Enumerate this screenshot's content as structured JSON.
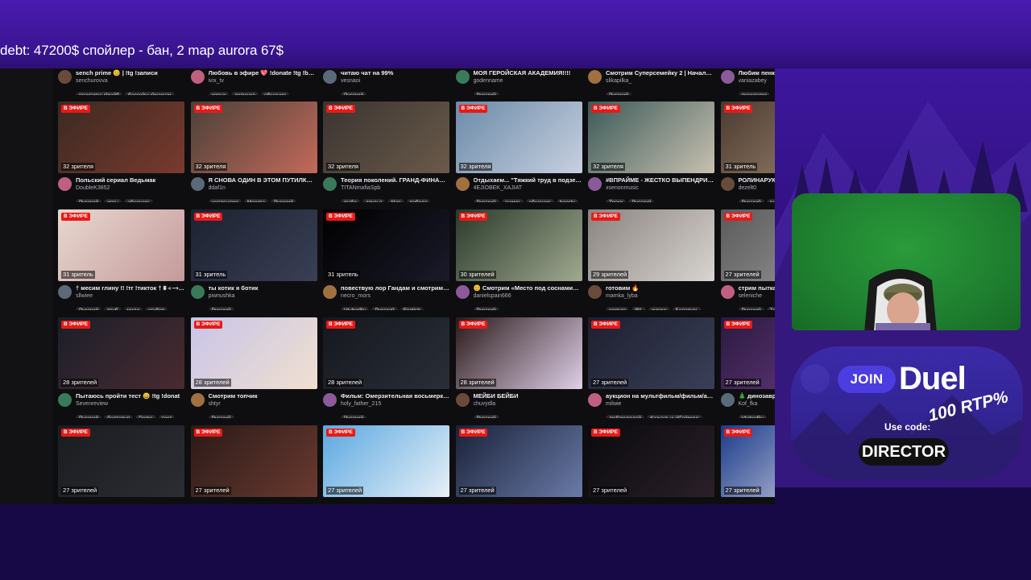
{
  "ticker": {
    "text": "debt: 47200$ спойлер - бан, 2 map aurora 67$"
  },
  "live_label": "В ЭФИРЕ",
  "colors": {
    "live_badge": "#e91916",
    "page_bg": "#0e0e10",
    "overlay_purple": "#3d179d",
    "greenscreen": "#1f8030"
  },
  "columns": [
    {
      "top": {
        "title": "sench prime 😊 | !tg !записи",
        "channel": "senchurovva",
        "tags": [
          "позитивныйвайб",
          "бассейныйжакузи"
        ]
      },
      "cards": [
        {
          "viewers": "32 зрителя",
          "title": "Польский сериал Ведьмак",
          "channel": "DoubleK3852",
          "tags": [
            "Русский",
            "игры",
            "общение"
          ],
          "thumb": [
            "#3a2a22",
            "#7a3a2e"
          ]
        },
        {
          "viewers": "31 зритель",
          "title": "† месим глину !! !тг !тикток † ⩩ ◃ ⟶ ⊀ ⟵",
          "channel": "sllwiee",
          "tags": [
            "Русский",
            "втуб",
            "мило",
            "ктубер"
          ],
          "thumb": [
            "#e8d8d0",
            "#c49a9a"
          ]
        },
        {
          "viewers": "28 зрителей",
          "title": "Пытаюсь пройти тест 😄 !tg !donat",
          "channel": "Sevenreview",
          "tags": [
            "Русский",
            "болтовня",
            "Demo",
            "тест"
          ],
          "thumb": [
            "#1a1f2a",
            "#4a2a30"
          ]
        },
        {
          "viewers": "27 зрителей",
          "title": "",
          "channel": "",
          "tags": [],
          "thumb": [
            "#1b1c20",
            "#2c2d33"
          ]
        }
      ]
    },
    {
      "top": {
        "title": "Любовь в эфире 💖 !donate !tg !boosty",
        "channel": "ivix_tv",
        "tags": [
          "хорни",
          "девушка",
          "общение"
        ]
      },
      "cards": [
        {
          "viewers": "32 зрителя",
          "title": "Я СНОВА ОДИН В ЭТОМ ПУТИЛКОВО ...",
          "channel": "ddaf1n",
          "tags": [
            "челленджи",
            "Москва",
            "Русский"
          ],
          "thumb": [
            "#4a4038",
            "#c26a5a"
          ]
        },
        {
          "viewers": "31 зритель",
          "title": "ты котик я ботик",
          "channel": "piwnushka",
          "tags": [
            "Русский"
          ],
          "thumb": [
            "#1c2230",
            "#3a3f55"
          ]
        },
        {
          "viewers": "28 зрителей",
          "title": "Смотрим топчик",
          "channel": "shtyr",
          "tags": [
            "Русский"
          ],
          "thumb": [
            "#c8c4e8",
            "#f0e0d0"
          ]
        },
        {
          "viewers": "27 зрителей",
          "title": "",
          "channel": "",
          "tags": [],
          "thumb": [
            "#2a1a18",
            "#6a3a30"
          ]
        }
      ]
    },
    {
      "top": {
        "title": "читаю чат на 99%",
        "channel": "vesnaoi",
        "tags": [
          "Русский"
        ]
      },
      "cards": [
        {
          "viewers": "32 зрителя",
          "title": "Теория поколений. ГРАНД-ФИНАЛ ко...",
          "channel": "TITANmafiaSpb",
          "tags": [
            "mafia",
            "друзья",
            "titan",
            "победа"
          ],
          "thumb": [
            "#3a3430",
            "#6a5a4a"
          ]
        },
        {
          "viewers": "31 зритель",
          "title": "повествую лор Гандам и смотрим Ган...",
          "channel": "necro_mors",
          "tags": [
            "VtuberRu",
            "Русский",
            "English"
          ],
          "thumb": [
            "#000000",
            "#1a1a2a"
          ]
        },
        {
          "viewers": "28 зрителей",
          "title": "Фильм: Омерзительная восьмерка. В...",
          "channel": "holy_father_215",
          "tags": [
            "Русский"
          ],
          "thumb": [
            "#15181e",
            "#2a2e38"
          ]
        },
        {
          "viewers": "27 зрителей",
          "title": "",
          "channel": "",
          "tags": [],
          "thumb": [
            "#5aa8e0",
            "#e8f0f8"
          ]
        }
      ]
    },
    {
      "top": {
        "title": "МОЯ ГЕРОЙСКАЯ АКАДЕМИЯ!!!!",
        "channel": "godenname",
        "tags": [
          "Русский"
        ]
      },
      "cards": [
        {
          "viewers": "32 зрителя",
          "title": "Отдыхаем... \"Тяжкий труд в подземе...",
          "channel": "4EJIOBEK_XAJIAT",
          "tags": [
            "Русский",
            "аниме",
            "общение",
            "boosty"
          ],
          "thumb": [
            "#6a8aa8",
            "#c8d0e0"
          ]
        },
        {
          "viewers": "30 зрителей",
          "title": "😊 Смотрим «Место под соснами» | !...",
          "channel": "danielspain666",
          "tags": [
            "Русский"
          ],
          "thumb": [
            "#2a3a2a",
            "#a0a890"
          ]
        },
        {
          "viewers": "28 зрителей",
          "title": "МЕЙБИ БЕЙБИ",
          "channel": "chuvydla",
          "tags": [
            "Русский"
          ],
          "thumb": [
            "#2a1a1a",
            "#e0d0e8"
          ]
        },
        {
          "viewers": "27 зрителей",
          "title": "",
          "channel": "",
          "tags": [],
          "thumb": [
            "#1a2238",
            "#6a7aa8"
          ]
        }
      ]
    },
    {
      "top": {
        "title": "Смотрим Суперсемейку 2 | Начало в ...",
        "channel": "slikapilka_",
        "tags": [
          "Русский"
        ]
      },
      "cards": [
        {
          "viewers": "32 зрителя",
          "title": "#ВПРАЙМЕ - ЖЕСТКО ВЫПЕНДРИВА...",
          "channel": "xsenonmusic",
          "tags": [
            "Треки",
            "Русский"
          ],
          "thumb": [
            "#3a5a58",
            "#c8c0b0"
          ]
        },
        {
          "viewers": "29 зрителей",
          "title": "готовим 🔥",
          "channel": "mamka_lyba",
          "tags": [
            "woman",
            "IRL",
            "кукинг",
            "Беларусь"
          ],
          "thumb": [
            "#8a8480",
            "#d8d4d0"
          ]
        },
        {
          "viewers": "27 зрителей",
          "title": "аукцион на мультфильм/фильм/аним...",
          "channel": "milwie",
          "tags": [
            "люблюлюдей",
            "КазуальныйГейминг"
          ],
          "thumb": [
            "#1e2030",
            "#3a3f58"
          ]
        },
        {
          "viewers": "27 зрителей",
          "title": "",
          "channel": "",
          "tags": [],
          "thumb": [
            "#0a0a0e",
            "#2a2028"
          ]
        }
      ]
    },
    {
      "top": {
        "title": "Любим пенку",
        "channel": "vaniazabey",
        "tags": [
          "посиделки"
        ]
      },
      "cards": [
        {
          "viewers": "31 зритель",
          "title": "РОЛИНАРУКИ",
          "channel": "dezelt0",
          "tags": [
            "Русский",
            "ru"
          ],
          "thumb": [
            "#4a3a30",
            "#a08870"
          ]
        },
        {
          "viewers": "27 зрителей",
          "title": "стрим пытка...",
          "channel": "seleniche",
          "tags": [
            "Русский",
            "Тест"
          ],
          "thumb": [
            "#5a5a5a",
            "#9a9a9a"
          ]
        },
        {
          "viewers": "27 зрителей",
          "title": "🎄 динозаври...",
          "channel": "Kof_fka",
          "tags": [
            "VtuberRu"
          ],
          "thumb": [
            "#2a1a40",
            "#6a3a80"
          ]
        },
        {
          "viewers": "27 зрителей",
          "title": "",
          "channel": "",
          "tags": [],
          "thumb": [
            "#1a3a8a",
            "#d8d8e8"
          ]
        }
      ]
    }
  ],
  "promo": {
    "join_label": "JOIN",
    "brand": "Duel",
    "use_code_label": "Use code:",
    "rtp_text": "100 RTP%",
    "code": "DIRECTOR"
  }
}
